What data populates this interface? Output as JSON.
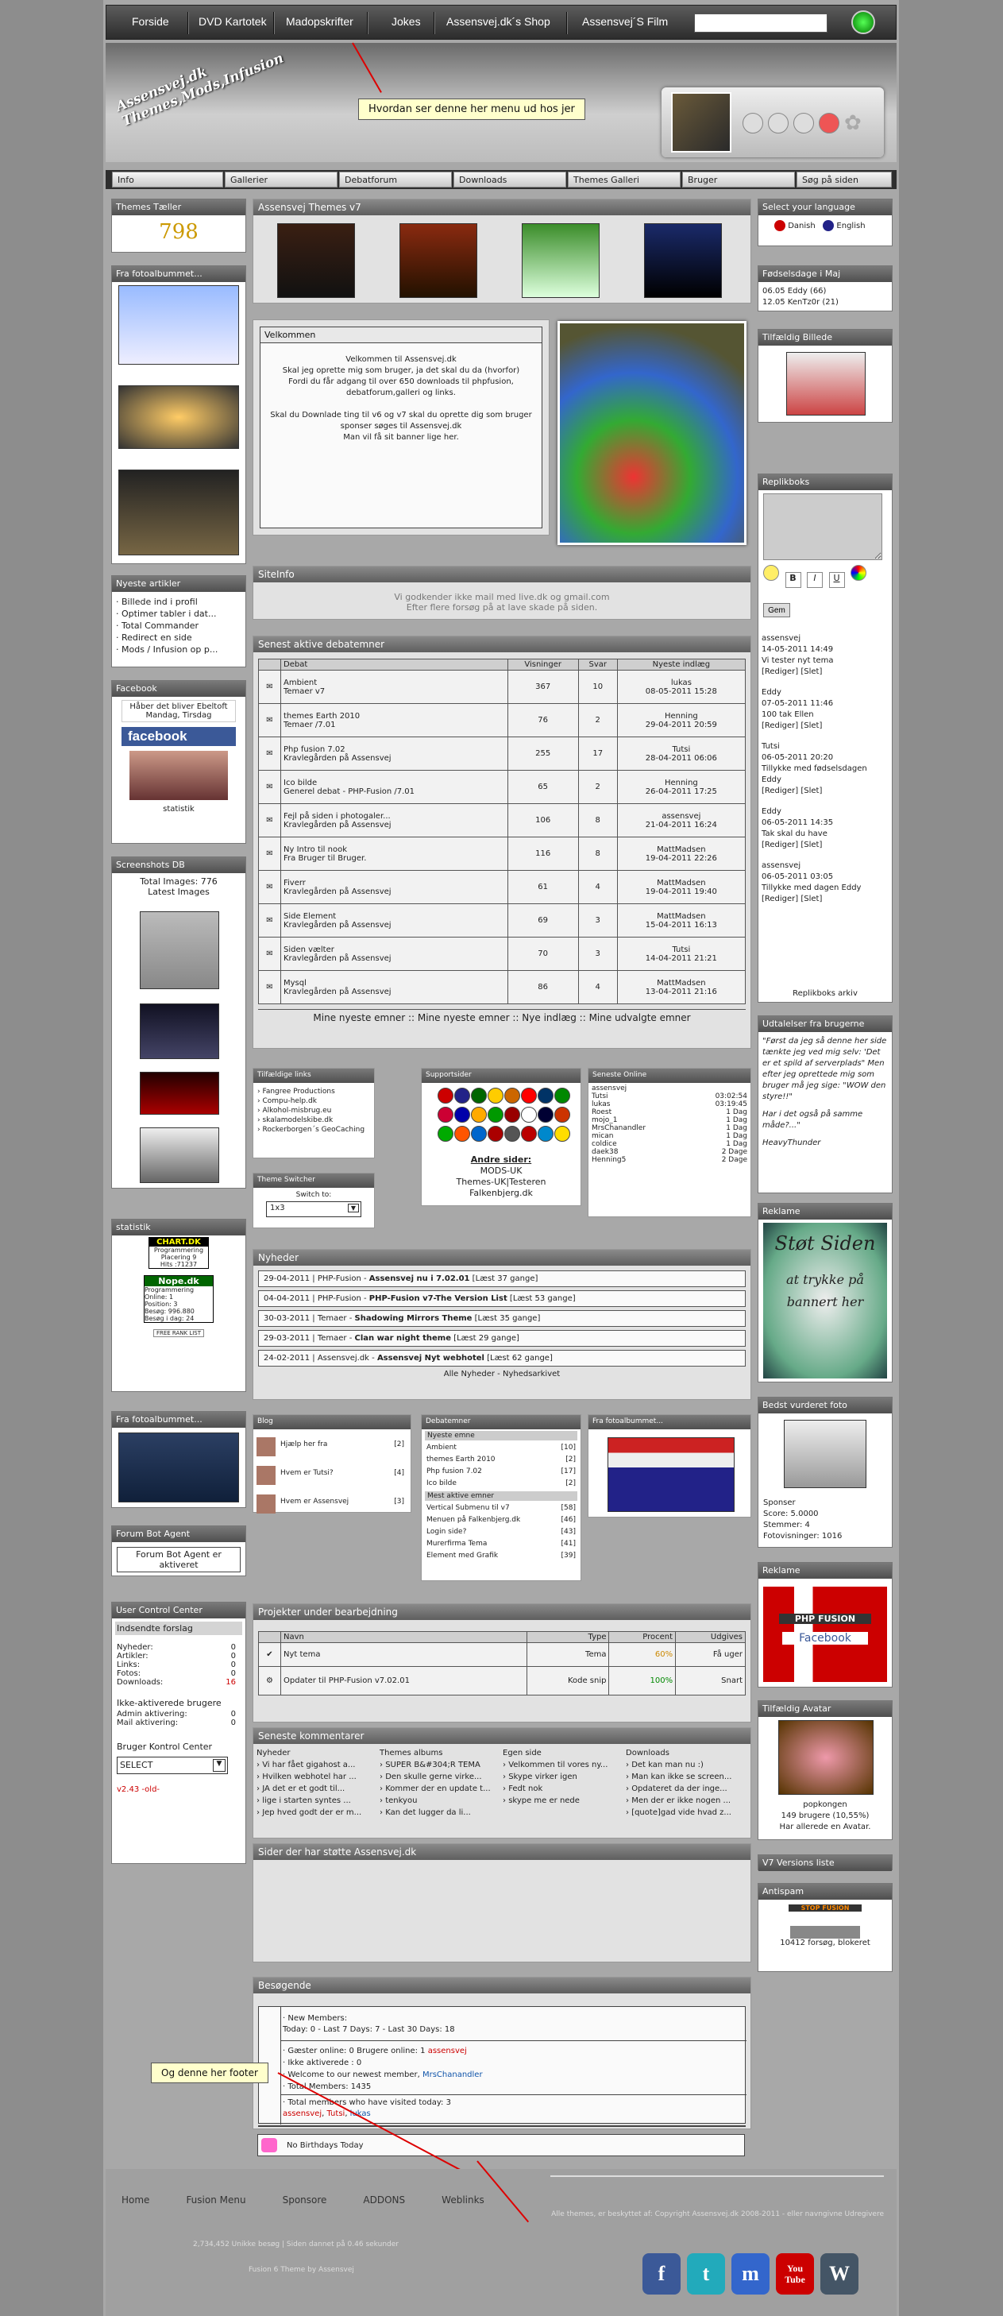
{
  "topnav": {
    "items": [
      "Forside",
      "DVD Kartotek",
      "Madopskrifter",
      "Jokes",
      "Assensvej.dk´s Shop",
      "Assensvej´S Film"
    ]
  },
  "header": {
    "logo_line1": "Assensvej.dk",
    "logo_line2": "Themes,Mods,Infusion",
    "callout_menu": "Hvordan ser denne her menu ud hos jer",
    "callout_footer": "Og denne her footer"
  },
  "nav2": [
    "Info",
    "Gallerier",
    "Debatforum",
    "Downloads",
    "Themes Galleri",
    "Bruger",
    "Søg på siden"
  ],
  "left": {
    "themes_taeller": {
      "title": "Themes Tæller",
      "count": "798"
    },
    "fotoalbum1": {
      "title": "Fra fotoalbummet..."
    },
    "nyeste": {
      "title": "Nyeste artikler",
      "items": [
        "Billede ind i profil",
        "Optimer tabler i dat...",
        "Total Commander",
        "Redirect en side",
        "Mods / Infusion op p..."
      ]
    },
    "facebook": {
      "title": "Facebook",
      "text": "Håber det bliver Ebeltoft Mandag, Tirsdag",
      "logo": "facebook",
      "sub": "statistik"
    },
    "screenshots": {
      "title": "Screenshots DB",
      "total": "Total Images: 776",
      "latest": "Latest Images"
    },
    "statistik": {
      "title": "statistik",
      "chart": "CHART.DK",
      "chart_lines": [
        "Programmering",
        "Placering  9",
        "Hits  :71237"
      ],
      "nope": "Nope.dk",
      "nope_lines": [
        "Programmering",
        "Online:  1",
        "Position:  3",
        "Besøg:  996.880",
        "Besøg i dag:  24"
      ],
      "small": "FREE RANK LIST"
    },
    "fotoalbum2": {
      "title": "Fra fotoalbummet..."
    },
    "botagent": {
      "title": "Forum Bot Agent",
      "text": "Forum Bot Agent er aktiveret"
    },
    "ucc": {
      "title": "User Control Center",
      "sub": "Indsendte forslag",
      "rows": [
        [
          "Nyheder:",
          "0"
        ],
        [
          "Artikler:",
          "0"
        ],
        [
          "Links:",
          "0"
        ],
        [
          "Fotos:",
          "0"
        ],
        [
          "Downloads:",
          "16"
        ]
      ],
      "inactive": "Ikke-aktiverede brugere",
      "inactive_rows": [
        [
          "Admin aktivering:",
          "0"
        ],
        [
          "Mail aktivering:",
          "0"
        ]
      ],
      "bkc": "Bruger Kontrol Center",
      "select": "SELECT",
      "version": "v2.43",
      "version_suffix": "-old-"
    }
  },
  "center": {
    "themes_v7": {
      "title": "Assensvej Themes v7"
    },
    "velkommen": {
      "title": "Velkommen",
      "lines": [
        "Velkommen til Assensvej.dk",
        "Skal jeg oprette mig som bruger,  ja det skal du da (hvorfor)",
        "Fordi du får adgang til over 650 downloads til phpfusion,",
        "debatforum,galleri og links.",
        "",
        "Skal du Downlade ting til v6 og v7 skal du oprette dig som bruger",
        "sponser søges til Assensvej.dk",
        "Man vil få sit banner lige her."
      ]
    },
    "siteinfo": {
      "title": "SiteInfo",
      "lines": [
        "Vi godkender ikke mail med live.dk og gmail.com",
        "Efter flere forsøg på at lave skade på siden."
      ]
    },
    "forum": {
      "title": "Senest aktive debatemner",
      "headers": [
        "Debat",
        "Visninger",
        "Svar",
        "Nyeste indlæg"
      ],
      "rows": [
        [
          "Ambient",
          "Temaer v7",
          "367",
          "10",
          "lukas",
          "08-05-2011 15:28"
        ],
        [
          "themes Earth 2010",
          "Temaer /7.01",
          "76",
          "2",
          "Henning",
          "29-04-2011 20:59"
        ],
        [
          "Php fusion 7.02",
          "Kravlegården på Assensvej",
          "255",
          "17",
          "Tutsi",
          "28-04-2011 06:06"
        ],
        [
          "Ico bilde",
          "Generel debat - PHP-Fusion /7.01",
          "65",
          "2",
          "Henning",
          "26-04-2011 17:25"
        ],
        [
          "Fejl på siden i photogaler...",
          "Kravlegården på Assensvej",
          "106",
          "8",
          "assensvej",
          "21-04-2011 16:24"
        ],
        [
          "Ny Intro til nook",
          "Fra Bruger til Bruger.",
          "116",
          "8",
          "MattMadsen",
          "19-04-2011 22:26"
        ],
        [
          "Fiverr",
          "Kravlegården på Assensvej",
          "61",
          "4",
          "MattMadsen",
          "19-04-2011 19:40"
        ],
        [
          "Side Element",
          "Kravlegården på Assensvej",
          "69",
          "3",
          "MattMadsen",
          "15-04-2011 16:13"
        ],
        [
          "Siden vælter",
          "Kravlegården på Assensvej",
          "70",
          "3",
          "Tutsi",
          "14-04-2011 21:21"
        ],
        [
          "Mysql",
          "Kravlegården på Assensvej",
          "86",
          "4",
          "MattMadsen",
          "13-04-2011 21:16"
        ]
      ],
      "footer": "Mine nyeste emner :: Mine nyeste emner :: Nye indlæg :: Mine udvalgte emner"
    },
    "links": {
      "title": "Tilfældige links",
      "items": [
        "Fangree Productions",
        "Compu-help.dk",
        "Alkohol-misbrug.eu",
        "skalamodelskibe.dk",
        "Rockerborgen´s GeoCaching"
      ]
    },
    "support": {
      "title": "Supportsider",
      "andre": "Andre sider:",
      "lines": [
        "MODS-UK",
        "Themes-UK|Testeren",
        "Falkenbjerg.dk"
      ]
    },
    "online": {
      "title": "Seneste Online",
      "rows": [
        [
          "assensvej",
          ""
        ],
        [
          "Tutsi",
          "03:02:54"
        ],
        [
          "lukas",
          "03:19:45"
        ],
        [
          "Roest",
          "1 Dag"
        ],
        [
          "mojo_1",
          "1 Dag"
        ],
        [
          "MrsChanandler",
          "1 Dag"
        ],
        [
          "mican",
          "1 Dag"
        ],
        [
          "coldice",
          "1 Dag"
        ],
        [
          "daek38",
          "2 Dage"
        ],
        [
          "Henning5",
          "2 Dage"
        ]
      ]
    },
    "switcher": {
      "title": "Theme Switcher",
      "label": "Switch to:",
      "value": "1x3"
    },
    "nyheder": {
      "title": "Nyheder",
      "items": [
        [
          "29-04-2011 | PHP-Fusion - ",
          "Assensvej nu i 7.02.01",
          " [Læst 37 gange]"
        ],
        [
          "04-04-2011 | PHP-Fusion - ",
          "PHP-Fusion v7-The Version List",
          " [Læst 53 gange]"
        ],
        [
          "30-03-2011 | Temaer - ",
          "Shadowing Mirrors Theme",
          " [Læst 35 gange]"
        ],
        [
          "29-03-2011 | Temaer - ",
          "Clan war night theme",
          " [Læst 29 gange]"
        ],
        [
          "24-02-2011 | Assensvej.dk - ",
          "Assensvej Nyt webhotel",
          " [Læst 62 gange]"
        ]
      ],
      "footer": "Alle Nyheder - Nyhedsarkivet"
    },
    "blog": {
      "title": "Blog",
      "items": [
        [
          "Hjælp her fra",
          "[2]"
        ],
        [
          "Hvem er Tutsi?",
          "[4]"
        ],
        [
          "Hvem er Assensvej",
          "[3]"
        ]
      ]
    },
    "debatemner": {
      "title": "Debatemner",
      "sub1": "Nyeste emne",
      "items1": [
        [
          "Ambient",
          "[10]"
        ],
        [
          "themes Earth 2010",
          "[2]"
        ],
        [
          "Php fusion 7.02",
          "[17]"
        ],
        [
          "Ico bilde",
          "[2]"
        ]
      ],
      "sub2": "Mest aktive emner",
      "items2": [
        [
          "Vertical Submenu til v7",
          "[58]"
        ],
        [
          "Menuen på Falkenbjerg.dk",
          "[46]"
        ],
        [
          "Login side?",
          "[43]"
        ],
        [
          "Murerfirma Tema",
          "[41]"
        ],
        [
          "Element med Grafik",
          "[39]"
        ]
      ]
    },
    "fotoalbum3": {
      "title": "Fra fotoalbummet..."
    },
    "projekter": {
      "title": "Projekter under bearbejdning",
      "headers": [
        "Navn",
        "Type",
        "Procent",
        "Udgives"
      ],
      "rows": [
        [
          "Nyt tema",
          "Tema",
          "60%",
          "Få uger"
        ],
        [
          "Opdater til PHP-Fusion v7.02.01",
          "Kode snip",
          "100%",
          "Snart"
        ]
      ]
    },
    "kommentarer": {
      "title": "Seneste kommentarer",
      "cols": [
        {
          "h": "Nyheder",
          "items": [
            "Vi har fået gigahost a...",
            "Hvilken webhotel har ...",
            "JA det er et godt til...",
            "lige i starten syntes ...",
            "Jep hved godt der er m..."
          ]
        },
        {
          "h": "Themes albums",
          "items": [
            "SUPER B&#304;R TEMA",
            "Den skulle gerne virke...",
            "Kommer der en update t...",
            "tenkyou",
            "Kan det lugger da li..."
          ]
        },
        {
          "h": "Egen side",
          "items": [
            "Velkommen til vores ny...",
            "Skype virker igen",
            "Fedt nok",
            "skype me er nede"
          ]
        },
        {
          "h": "Downloads",
          "items": [
            "Det kan man nu :)",
            "Man kan ikke se screen...",
            "Opdateret da der inge...",
            "Men der er ikke nogen ...",
            "[quote]gad vide hvad z..."
          ]
        }
      ]
    },
    "stoette": {
      "title": "Sider der har støtte Assensvej.dk"
    },
    "besogende": {
      "title": "Besøgende",
      "new_members": "New Members:",
      "counts": "Today: 0 - Last 7 Days: 7 - Last 30 Days: 18",
      "guests": "Gæster online: 0 Brugere online: 1 ",
      "guests_user": "assensvej",
      "inactive": "Ikke aktiverede : 0",
      "welcome": "Welcome to our newest member, ",
      "newest": "MrsChanandler",
      "total": "Total Members: 1435",
      "visited": "Total members who have visited today: 3",
      "visited_users": [
        "assensvej",
        ", ",
        "Tutsi",
        ", ",
        "lukas"
      ],
      "birthday": "No Birthdays Today"
    }
  },
  "right": {
    "language": {
      "title": "Select your language",
      "items": [
        "Danish",
        "English"
      ]
    },
    "birthdays": {
      "title": "Fødselsdage i Maj",
      "items": [
        "06.05 Eddy (66)",
        "12.05 KenTz0r (21)"
      ]
    },
    "random_pic": {
      "title": "Tilfældig Billede"
    },
    "shoutbox": {
      "title": "Replikboks",
      "button": "Gem",
      "entries": [
        [
          "assensvej",
          "14-05-2011 14:49",
          "Vi tester nyt tema",
          "[Rediger] [Slet]"
        ],
        [
          "Eddy",
          "07-05-2011 11:46",
          "100 tak Ellen",
          "[Rediger] [Slet]"
        ],
        [
          "Tutsi",
          "06-05-2011 20:20",
          "Tillykke med fødselsdagen Eddy",
          "[Rediger] [Slet]"
        ],
        [
          "Eddy",
          "06-05-2011 14:35",
          "Tak skal du have",
          "[Rediger] [Slet]"
        ],
        [
          "assensvej",
          "06-05-2011 03:05",
          "Tillykke med dagen Eddy",
          "[Rediger] [Slet]"
        ]
      ],
      "archive": "Replikboks arkiv"
    },
    "quotes": {
      "title": "Udtalelser fra brugerne",
      "text": "\"Først da jeg så denne her side tænkte jeg ved mig selv: 'Det er et spild af serverplads\" Men efter jeg oprettede mig som bruger må jeg sige: \"WOW den styre!!\"",
      "text2": "Har i det også på samme måde?...\"",
      "author": "HeavyThunder"
    },
    "reklame1": {
      "title": "Reklame",
      "text": "Støt Siden",
      "text2": "at trykke på bannert her"
    },
    "best_photo": {
      "title": "Bedst vurderet foto",
      "sponser": "Sponser",
      "score": "Score: 5.0000",
      "stemmer": "Stemmer: 4",
      "visninger": "Fotovisninger: 1016"
    },
    "reklame2": {
      "title": "Reklame",
      "brand": "PHP FUSION",
      "sub": "Facebook"
    },
    "avatar": {
      "title": "Tilfældig Avatar",
      "name": "popkongen",
      "users": "149 brugere (10,55%)",
      "note": "Har allerede en Avatar."
    },
    "versions": {
      "title": "V7 Versions liste"
    },
    "antispam": {
      "title": "Antispam",
      "badge": "STOP FUSION",
      "blocked": "10412 forsøg, blokeret"
    }
  },
  "footer": {
    "links": [
      "Home",
      "Fusion Menu",
      "Sponsore",
      "ADDONS",
      "Weblinks"
    ],
    "copyright": "Alle themes, er beskyttet af: Copyright Assensvej.dk 2008-2011 - eller navngivne Udregivere",
    "stats": "2,734,452 Unikke besøg | Siden dannet på 0.46 sekunder",
    "theme": "Fusion 6 Theme by Assensvej",
    "social": [
      "f",
      "t",
      "m",
      "You Tube",
      "W"
    ]
  },
  "colors": {
    "accent": "#cc0000",
    "facebook": "#3b5998"
  }
}
